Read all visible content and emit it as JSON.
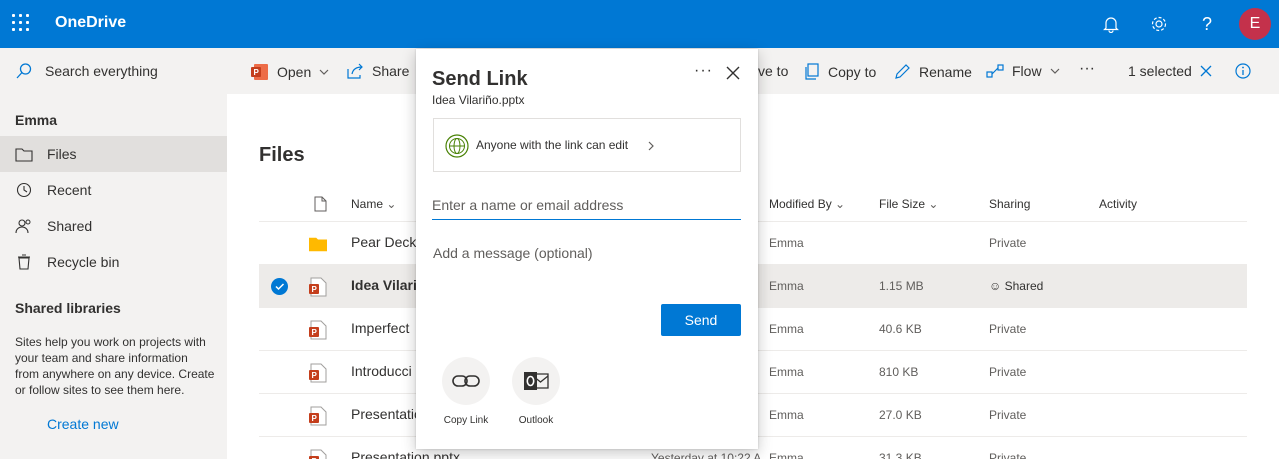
{
  "app": {
    "title": "OneDrive",
    "avatar_initial": "E",
    "accent": "#0078d4",
    "avatar_color": "#c4314b"
  },
  "search": {
    "placeholder": "Search everything"
  },
  "commands": {
    "open": "Open",
    "share": "Share",
    "move_to": "ve to",
    "copy_to": "Copy to",
    "rename": "Rename",
    "flow": "Flow",
    "more": "···",
    "selected": "1 selected"
  },
  "sidebar": {
    "user": "Emma",
    "items": [
      {
        "label": "Files",
        "icon": "folder-icon",
        "active": true
      },
      {
        "label": "Recent",
        "icon": "clock-icon",
        "active": false
      },
      {
        "label": "Shared",
        "icon": "people-icon",
        "active": false
      },
      {
        "label": "Recycle bin",
        "icon": "trash-icon",
        "active": false
      }
    ],
    "libraries_heading": "Shared libraries",
    "libraries_desc": "Sites help you work on projects with your team and share information from anywhere on any device. Create or follow sites to see them here.",
    "create_new": "Create new"
  },
  "main": {
    "title": "Files",
    "columns": {
      "name": "Name",
      "modified_by": "Modified By",
      "file_size": "File Size",
      "sharing": "Sharing",
      "activity": "Activity"
    },
    "rows": [
      {
        "name": "Pear Deck",
        "type": "folder",
        "modified_by": "Emma",
        "size": "",
        "sharing": "Private",
        "selected": false
      },
      {
        "name": "Idea Vilari",
        "type": "pptx",
        "modified_by": "Emma",
        "size": "1.15 MB",
        "sharing": "Shared",
        "selected": true
      },
      {
        "name": "Imperfect",
        "type": "pptx",
        "modified_by": "Emma",
        "size": "40.6 KB",
        "sharing": "Private",
        "selected": false
      },
      {
        "name": "Introducci",
        "type": "pptx",
        "modified_by": "Emma",
        "size": "810 KB",
        "sharing": "Private",
        "selected": false
      },
      {
        "name": "Presentatio",
        "type": "pptx",
        "modified_by": "Emma",
        "size": "27.0 KB",
        "sharing": "Private",
        "selected": false
      },
      {
        "name": "Presentation.pptx",
        "type": "pptx",
        "modified": "Yesterday at 10:22 A",
        "modified_by": "Emma",
        "size": "31.3 KB",
        "sharing": "Private",
        "selected": false
      }
    ]
  },
  "panel": {
    "title": "Send Link",
    "file_name": "Idea Vilariño.pptx",
    "permission": "Anyone with the link can edit",
    "email_placeholder": "Enter a name or email address",
    "message_placeholder": "Add a message (optional)",
    "send": "Send",
    "more": "···",
    "options": [
      {
        "label": "Copy Link",
        "icon": "link-icon"
      },
      {
        "label": "Outlook",
        "icon": "outlook-icon"
      }
    ]
  }
}
